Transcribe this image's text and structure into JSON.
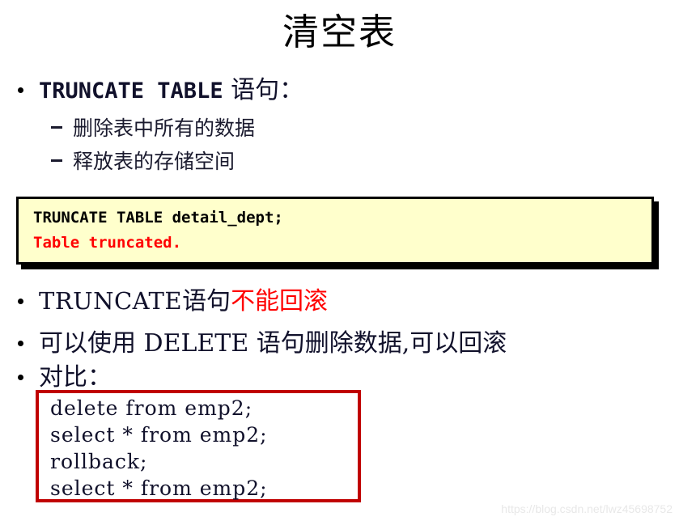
{
  "slide": {
    "title": "清空表",
    "bullets": [
      {
        "marker": "dot",
        "code_part": "TRUNCATE TABLE",
        "tail_part": "  语句："
      },
      {
        "marker": "dot",
        "lead_part": "TRUNCATE",
        "mid_part": "语句",
        "emph_part": "不能回滚"
      },
      {
        "marker": "dot",
        "text": "可以使用  DELETE  语句删除数据,可以回滚"
      },
      {
        "marker": "dot",
        "text": "对比："
      }
    ],
    "sub_bullets": [
      {
        "marker": "dash",
        "text": "删除表中所有的数据"
      },
      {
        "marker": "dash",
        "text": "释放表的存储空间"
      }
    ],
    "code_box_top": {
      "lines": [
        {
          "text": "TRUNCATE TABLE detail_dept;",
          "color": "#000000"
        },
        {
          "text": "Table truncated.",
          "color": "#ff0000"
        }
      ],
      "background": "#ffffcc",
      "border_color": "#000000"
    },
    "code_box_bottom": {
      "lines": [
        {
          "text": "delete from emp2;"
        },
        {
          "text": "select * from emp2;"
        },
        {
          "text": "rollback;"
        },
        {
          "text": "select * from emp2;"
        }
      ],
      "background": "#ffffff",
      "border_color": "#c00000"
    },
    "watermark": "https://blog.csdn.net/lwz45698752",
    "accent_red": "#ff0000",
    "box_border_red": "#c00000"
  }
}
